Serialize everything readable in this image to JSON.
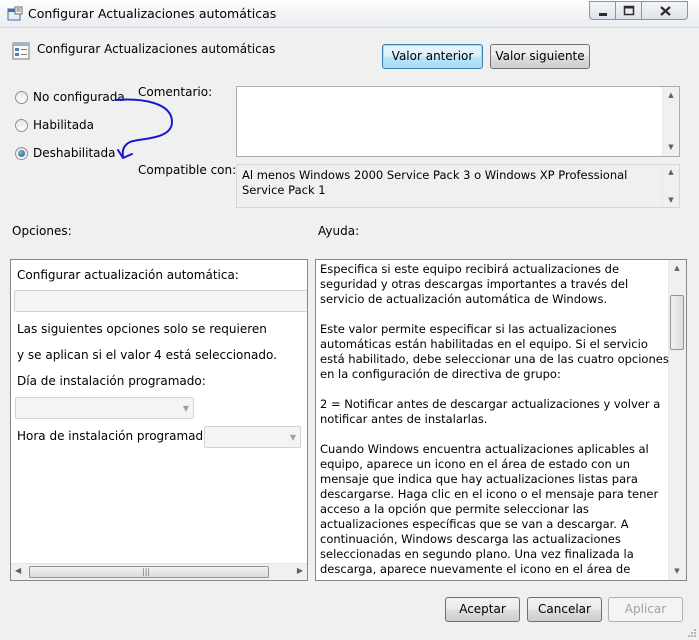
{
  "window": {
    "title": "Configurar Actualizaciones automáticas",
    "setting_name": "Configurar Actualizaciones automáticas"
  },
  "nav": {
    "prev_label": "Valor anterior",
    "next_label": "Valor siguiente"
  },
  "state": {
    "options": [
      {
        "label": "No configurada",
        "checked": false
      },
      {
        "label": "Habilitada",
        "checked": false
      },
      {
        "label": "Deshabilitada",
        "checked": true
      }
    ]
  },
  "comment": {
    "label": "Comentario:",
    "value": ""
  },
  "supported": {
    "label": "Compatible con:",
    "value": "Al menos Windows 2000 Service Pack 3 o Windows XP Professional Service Pack 1"
  },
  "options_panel": {
    "header": "Opciones:",
    "configure_label": "Configurar actualización automática:",
    "configure_value": "",
    "note_line1": "Las siguientes opciones solo se requieren",
    "note_line2": "y se aplican si el valor 4 está seleccionado.",
    "day_label": "Día de instalación programado:",
    "day_value": "",
    "time_label": "Hora de instalación programada:",
    "time_value": ""
  },
  "help_panel": {
    "header": "Ayuda:",
    "paragraphs": [
      "Especifica si este equipo recibirá actualizaciones de seguridad y otras descargas importantes a través del servicio de actualización automática de Windows.",
      "Este valor permite especificar si las actualizaciones automáticas están habilitadas en el equipo. Si el servicio está habilitado, debe seleccionar una de las cuatro opciones en la configuración de directiva de grupo:",
      "2 = Notificar antes de descargar actualizaciones y volver a notificar antes de instalarlas.",
      "Cuando Windows encuentra actualizaciones aplicables al equipo, aparece un icono en el área de estado con un mensaje que indica que hay actualizaciones listas para descargarse. Haga clic en el icono o el mensaje para tener acceso a la opción que permite seleccionar las actualizaciones específicas que se van a descargar. A continuación, Windows descarga las actualizaciones seleccionadas en segundo plano. Una vez finalizada la descarga, aparece nuevamente el icono en el área de estado y se notifica que las actualizaciones ya se pueden instalar. Haga clic en el"
    ]
  },
  "footer": {
    "ok_label": "Aceptar",
    "cancel_label": "Cancelar",
    "apply_label": "Aplicar"
  },
  "colors": {
    "annotation": "#1a1acc",
    "focus_border": "#3c7fb1"
  }
}
